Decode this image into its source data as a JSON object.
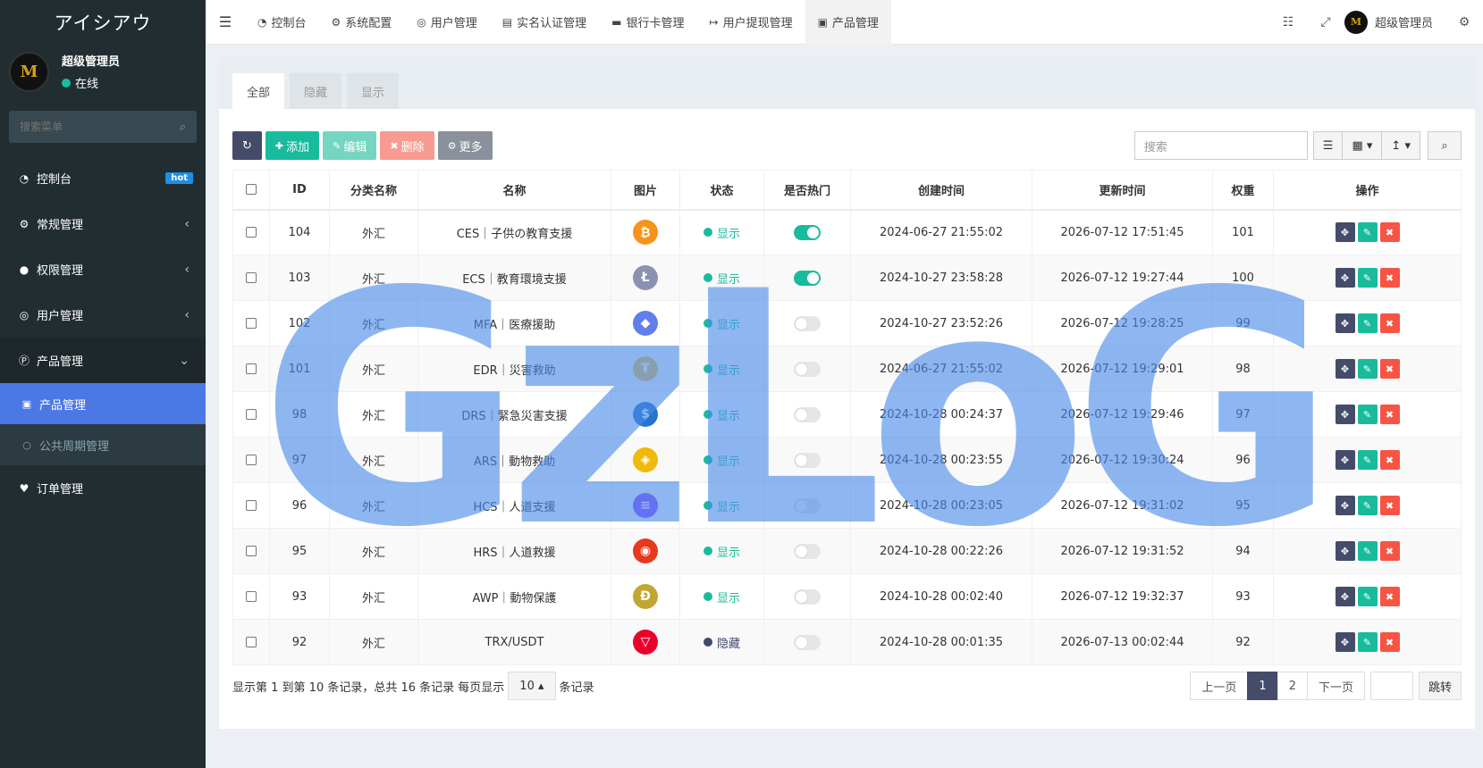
{
  "brand": "アイシアウ",
  "user": {
    "name": "超级管理员",
    "status": "在线",
    "avatar_text": "M"
  },
  "sidebar": {
    "search_placeholder": "搜索菜单",
    "items": [
      {
        "label": "控制台",
        "icon": "dashboard-icon",
        "badge": "hot"
      },
      {
        "label": "常规管理",
        "icon": "cogs-icon"
      },
      {
        "label": "权限管理",
        "icon": "group-icon"
      },
      {
        "label": "用户管理",
        "icon": "user-icon"
      },
      {
        "label": "产品管理",
        "icon": "product-icon"
      }
    ],
    "sub_items": [
      {
        "label": "产品管理",
        "icon": "shopping-bag-icon"
      },
      {
        "label": "公共周期管理",
        "icon": "circle-icon"
      }
    ],
    "last_item": {
      "label": "订单管理",
      "icon": "heartbeat-icon"
    }
  },
  "header": {
    "tabs": [
      {
        "label": "控制台",
        "icon": "dashboard-icon"
      },
      {
        "label": "系统配置",
        "icon": "cog-icon"
      },
      {
        "label": "用户管理",
        "icon": "user-icon"
      },
      {
        "label": "实名认证管理",
        "icon": "id-card-icon"
      },
      {
        "label": "银行卡管理",
        "icon": "credit-card-icon"
      },
      {
        "label": "用户提现管理",
        "icon": "sign-out-icon"
      },
      {
        "label": "产品管理",
        "icon": "shopping-bag-icon"
      }
    ],
    "user_name": "超级管理员"
  },
  "panel": {
    "tabs": [
      "全部",
      "隐藏",
      "显示"
    ],
    "toolbar": {
      "add": "添加",
      "edit": "编辑",
      "delete": "删除",
      "more": "更多",
      "search_placeholder": "搜索"
    }
  },
  "table": {
    "columns": [
      "ID",
      "分类名称",
      "名称",
      "图片",
      "状态",
      "是否热门",
      "创建时间",
      "更新时间",
      "权重",
      "操作"
    ],
    "rows": [
      {
        "id": "104",
        "cat": "外汇",
        "name": "CES｜子供の教育支援",
        "coin": "bitcoin",
        "coin_color": "#f7931a",
        "coin_glyph": "₿",
        "status": "显示",
        "status_color": "#18bc9c",
        "hot": true,
        "created": "2024-06-27 21:55:02",
        "updated": "2026-07-12 17:51:45",
        "weight": "101"
      },
      {
        "id": "103",
        "cat": "外汇",
        "name": "ECS｜教育環境支援",
        "coin": "litecoin",
        "coin_color": "#8a92b2",
        "coin_glyph": "Ł",
        "status": "显示",
        "status_color": "#18bc9c",
        "hot": true,
        "created": "2024-10-27 23:58:28",
        "updated": "2026-07-12 19:27:44",
        "weight": "100"
      },
      {
        "id": "102",
        "cat": "外汇",
        "name": "MFA｜医療援助",
        "coin": "ethereum",
        "coin_color": "#627eea",
        "coin_glyph": "◆",
        "status": "显示",
        "status_color": "#18bc9c",
        "hot": false,
        "created": "2024-10-27 23:52:26",
        "updated": "2026-07-12 19:28:25",
        "weight": "99"
      },
      {
        "id": "101",
        "cat": "外汇",
        "name": "EDR｜災害救助",
        "coin": "tether",
        "coin_color": "#f3c14b",
        "coin_glyph": "₮",
        "status": "显示",
        "status_color": "#18bc9c",
        "hot": false,
        "created": "2024-06-27 21:55:02",
        "updated": "2026-07-12 19:29:01",
        "weight": "98"
      },
      {
        "id": "98",
        "cat": "外汇",
        "name": "DRS｜緊急災害支援",
        "coin": "usd-coin",
        "coin_color": "#2775ca",
        "coin_glyph": "$",
        "status": "显示",
        "status_color": "#18bc9c",
        "hot": false,
        "created": "2024-10-28 00:24:37",
        "updated": "2026-07-12 19:29:46",
        "weight": "97"
      },
      {
        "id": "97",
        "cat": "外汇",
        "name": "ARS｜動物救助",
        "coin": "binance",
        "coin_color": "#f0b90b",
        "coin_glyph": "◈",
        "status": "显示",
        "status_color": "#18bc9c",
        "hot": false,
        "created": "2024-10-28 00:23:55",
        "updated": "2026-07-12 19:30:24",
        "weight": "96"
      },
      {
        "id": "96",
        "cat": "外汇",
        "name": "HCS｜人道支援",
        "coin": "solana",
        "coin_color": "#9945ff",
        "coin_glyph": "≡",
        "status": "显示",
        "status_color": "#18bc9c",
        "hot": false,
        "created": "2024-10-28 00:23:05",
        "updated": "2026-07-12 19:31:02",
        "weight": "95"
      },
      {
        "id": "95",
        "cat": "外汇",
        "name": "HRS｜人道救援",
        "coin": "shiba",
        "coin_color": "#e8391f",
        "coin_glyph": "◉",
        "status": "显示",
        "status_color": "#18bc9c",
        "hot": false,
        "created": "2024-10-28 00:22:26",
        "updated": "2026-07-12 19:31:52",
        "weight": "94"
      },
      {
        "id": "93",
        "cat": "外汇",
        "name": "AWP｜動物保護",
        "coin": "dogecoin",
        "coin_color": "#c2a633",
        "coin_glyph": "Ð",
        "status": "显示",
        "status_color": "#18bc9c",
        "hot": false,
        "created": "2024-10-28 00:02:40",
        "updated": "2026-07-12 19:32:37",
        "weight": "93"
      },
      {
        "id": "92",
        "cat": "外汇",
        "name": "TRX/USDT",
        "coin": "tron",
        "coin_color": "#eb0029",
        "coin_glyph": "▽",
        "status": "隐藏",
        "status_color": "#3d4a6b",
        "hot": false,
        "created": "2024-10-28 00:01:35",
        "updated": "2026-07-13 00:02:44",
        "weight": "92"
      }
    ]
  },
  "footer": {
    "info_prefix": "显示第 1 到第 10 条记录，总共 16 条记录 每页显示",
    "page_size": "10",
    "info_suffix": "条记录",
    "prev": "上一页",
    "pages": [
      "1",
      "2"
    ],
    "next": "下一页",
    "jump": "跳转"
  },
  "watermark": "GzLoG",
  "colors": {
    "sidebar_bg": "#222d32",
    "accent": "#4c78e6",
    "green": "#18bc9c",
    "dark_btn": "#444c69",
    "red": "#f75444"
  }
}
